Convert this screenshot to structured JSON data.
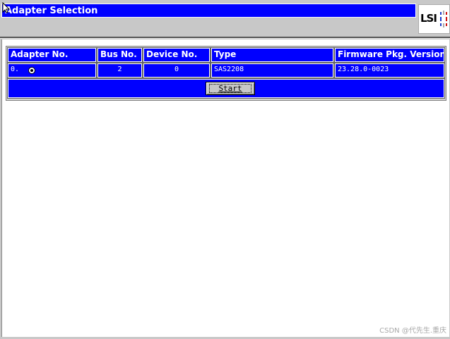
{
  "window": {
    "title": "Adapter Selection",
    "logo_text": "LSI"
  },
  "table": {
    "headers": [
      "Adapter No.",
      "Bus No.",
      "Device No.",
      "Type",
      "Firmware Pkg. Version"
    ],
    "rows": [
      {
        "adapter_no": "0.",
        "selected": true,
        "bus_no": "2",
        "device_no": "0",
        "type": "SAS2208",
        "firmware_version": "23.28.0-0023"
      }
    ]
  },
  "actions": {
    "start_label": "Start"
  },
  "watermark": "CSDN @代先生.重庆",
  "colors": {
    "panel_blue": "#0000ff",
    "background": "#c8c8c8",
    "content": "#ffffff"
  },
  "icons": [
    "mouse-pointer-icon",
    "lsi-logo",
    "radio-selected-icon"
  ]
}
